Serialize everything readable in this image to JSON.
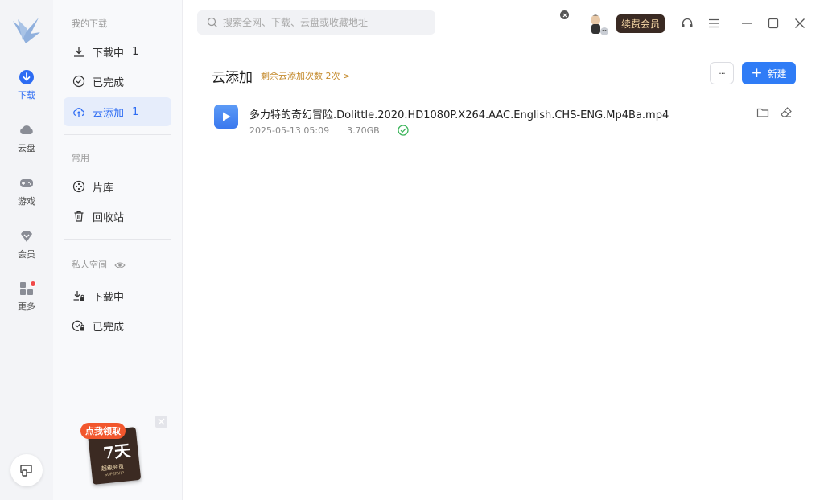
{
  "rail": {
    "items": [
      {
        "label": "下载",
        "icon": "download-icon",
        "active": true
      },
      {
        "label": "云盘",
        "icon": "cloud-icon"
      },
      {
        "label": "游戏",
        "icon": "gamepad-icon"
      },
      {
        "label": "会员",
        "icon": "diamond-icon"
      },
      {
        "label": "更多",
        "icon": "grid-icon",
        "badge": true
      }
    ],
    "accent": "#2d6cf3"
  },
  "nav": {
    "section_my": "我的下载",
    "downloading": {
      "label": "下载中",
      "count": "1"
    },
    "completed": {
      "label": "已完成"
    },
    "cloud_add": {
      "label": "云添加",
      "count": "1"
    },
    "section_common": "常用",
    "library": {
      "label": "片库"
    },
    "recycle": {
      "label": "回收站"
    },
    "section_private": "私人空间",
    "private_downloading": {
      "label": "下载中"
    },
    "private_completed": {
      "label": "已完成"
    }
  },
  "promo": {
    "tag": "点我领取",
    "days": "7天",
    "title": "超级会员",
    "subtitle": "SUPERVIP"
  },
  "search": {
    "placeholder": "搜索全网、下载、云盘或收藏地址"
  },
  "header": {
    "vip_button": "续费会员"
  },
  "main": {
    "title": "云添加",
    "remaining": "剩余云添加次数 2次 >",
    "new_button": "新建",
    "more_button": "···",
    "files": [
      {
        "name": "多力特的奇幻冒险.Dolittle.2020.HD1080P.X264.AAC.English.CHS-ENG.Mp4Ba.mp4",
        "date": "2025-05-13 05:09",
        "size": "3.70GB",
        "status": "completed"
      }
    ]
  },
  "colors": {
    "primary": "#2f7cf6",
    "vip_bg": "#3a2a23",
    "vip_text": "#f6d7a5",
    "remain_text": "#c48a2c",
    "success": "#3cb55b"
  }
}
